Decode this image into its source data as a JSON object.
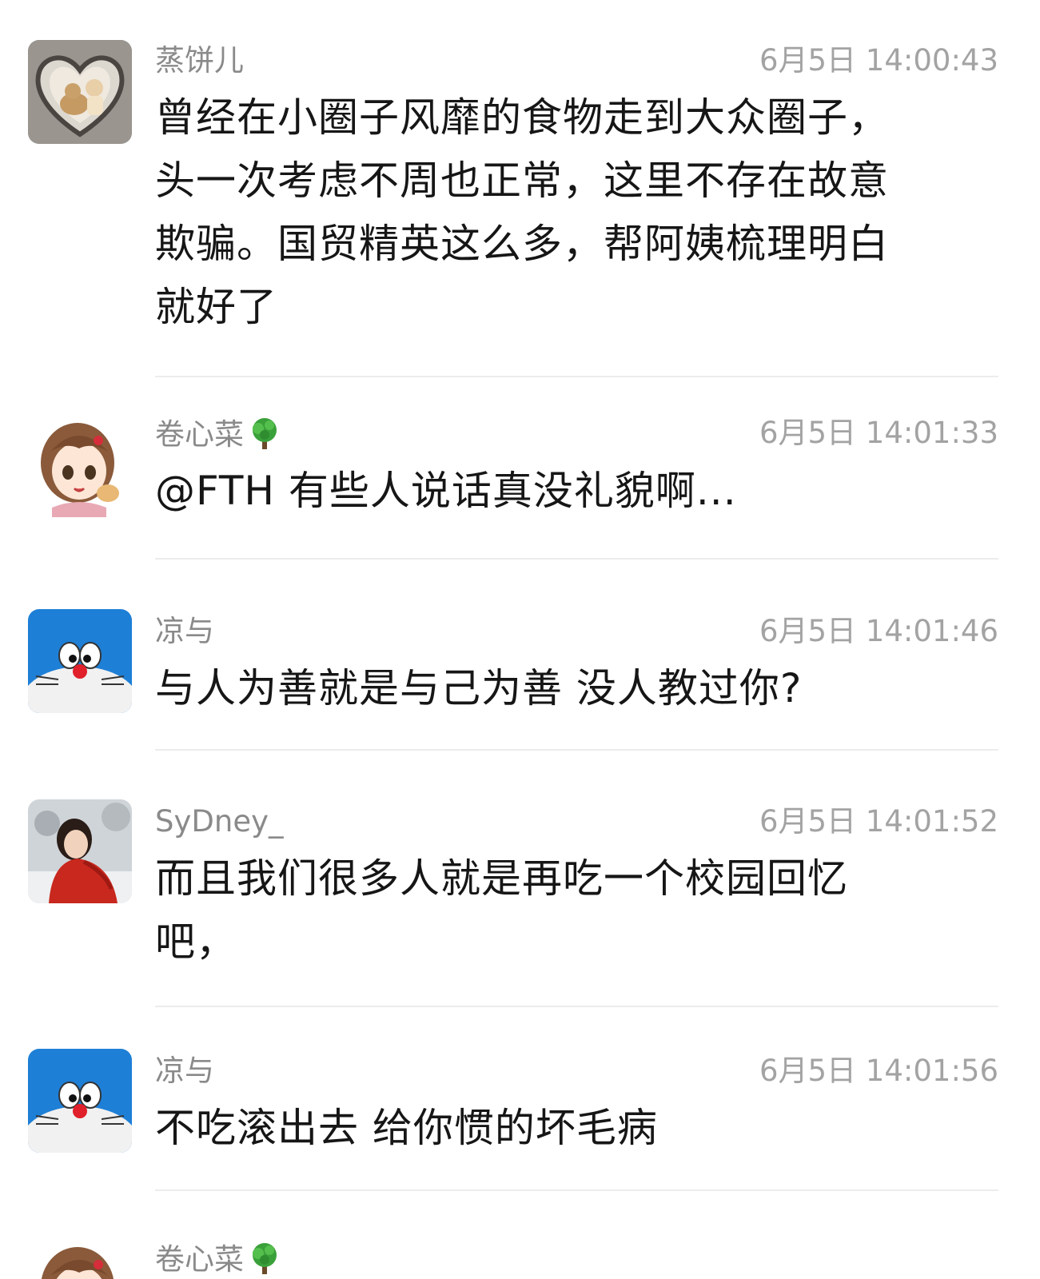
{
  "messages": [
    {
      "sender": "蒸饼儿",
      "avatar": "heart-frame-cat-avatar",
      "time": "6月5日 14:00:43",
      "lines": [
        "曾经在小圈子风靡的食物走到大众圈子，",
        "头一次考虑不周也正常，这里不存在故意",
        "欺骗。国贸精英这么多，帮阿姨梳理明白",
        "就好了"
      ]
    },
    {
      "sender": "卷心菜",
      "avatar": "anime-girl-avatar",
      "badge": "tree-emoji",
      "time": "6月5日 14:01:33",
      "lines": [
        "@FTH 有些人说话真没礼貌啊..."
      ]
    },
    {
      "sender": "凉与",
      "avatar": "doraemon-avatar",
      "time": "6月5日 14:01:46",
      "lines": [
        "与人为善就是与己为善 没人教过你?"
      ]
    },
    {
      "sender": "SyDney_",
      "avatar": "woman-red-coat-avatar",
      "time": "6月5日 14:01:52",
      "lines": [
        "而且我们很多人就是再吃一个校园回忆",
        "吧，"
      ]
    },
    {
      "sender": "凉与",
      "avatar": "doraemon-avatar",
      "time": "6月5日 14:01:56",
      "lines": [
        "不吃滚出去 给你惯的坏毛病"
      ]
    },
    {
      "sender": "卷心菜",
      "avatar": "anime-girl-avatar",
      "badge": "tree-emoji"
    }
  ]
}
